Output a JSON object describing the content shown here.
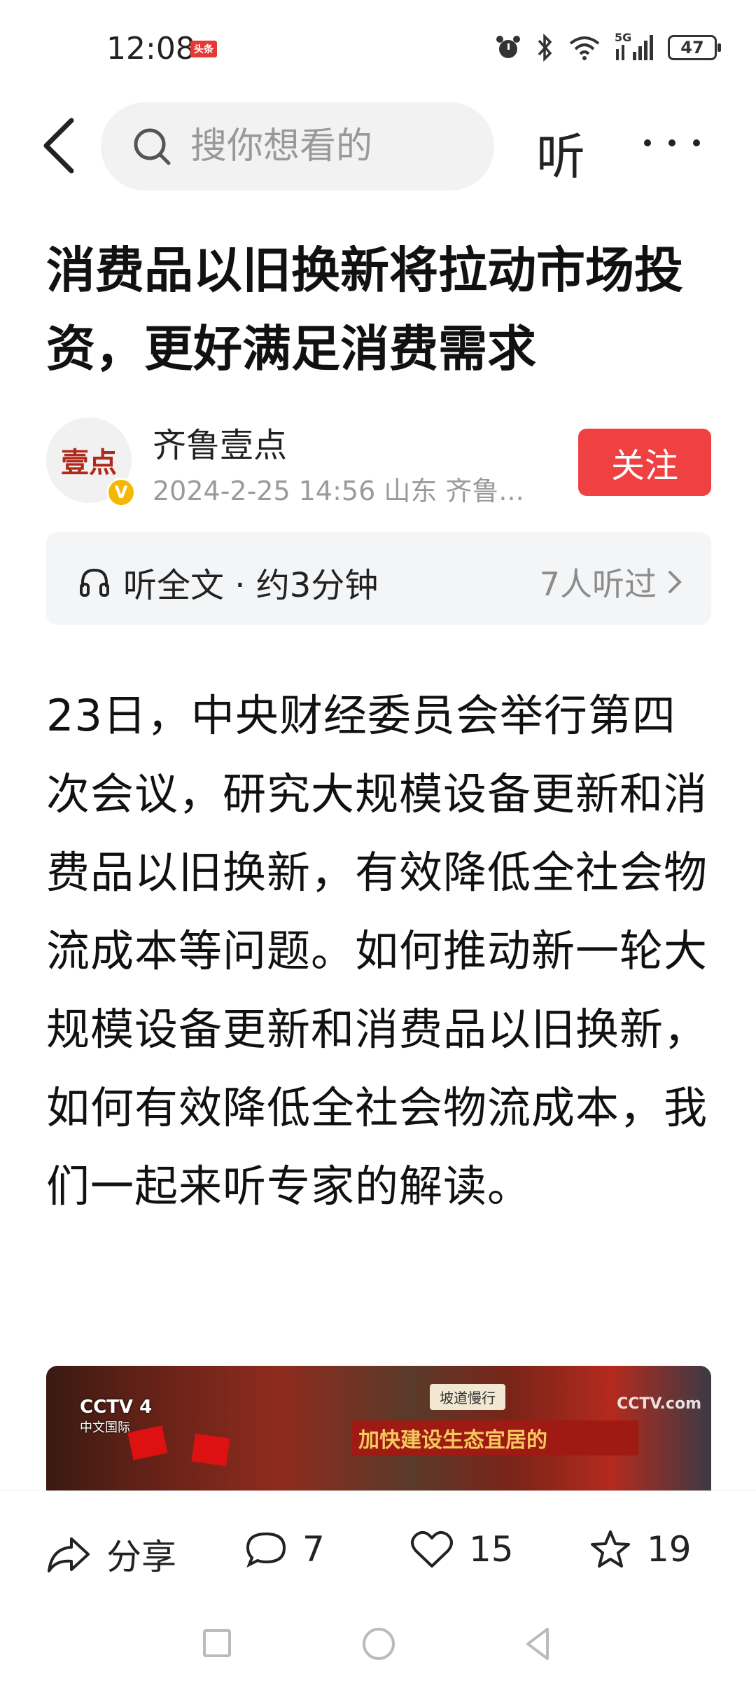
{
  "status_bar": {
    "time": "12:08",
    "news_badge": "头条",
    "network": "5G",
    "battery": "47"
  },
  "top_nav": {
    "search_placeholder": "搜你想看的",
    "listen_label": "听"
  },
  "article": {
    "title": "消费品以旧换新将拉动市场投资，更好满足消费需求",
    "author": {
      "avatar_text": "壹点",
      "verified_mark": "V",
      "name": "齐鲁壹点",
      "meta": "2024-2-25  14:56  山东  齐鲁...",
      "follow_label": "关注"
    },
    "audio": {
      "label": "听全文 · 约3分钟",
      "listeners": "7人听过"
    },
    "body": "23日，中央财经委员会举行第四次会议，研究大规模设备更新和消费品以旧换新，有效降低全社会物流成本等问题。如何推动新一轮大规模设备更新和消费品以旧换新，如何有效降低全社会物流成本，我们一起来听专家的解读。",
    "image": {
      "watermark": "CCTV 4",
      "watermark_sub": "中文国际",
      "sign_text": "坡道慢行",
      "banner_text": "加快建设生态宜居的",
      "watermark_right": "CCTV.com"
    }
  },
  "actions": {
    "share_label": "分享",
    "comments": "7",
    "likes": "15",
    "favorites": "19"
  }
}
